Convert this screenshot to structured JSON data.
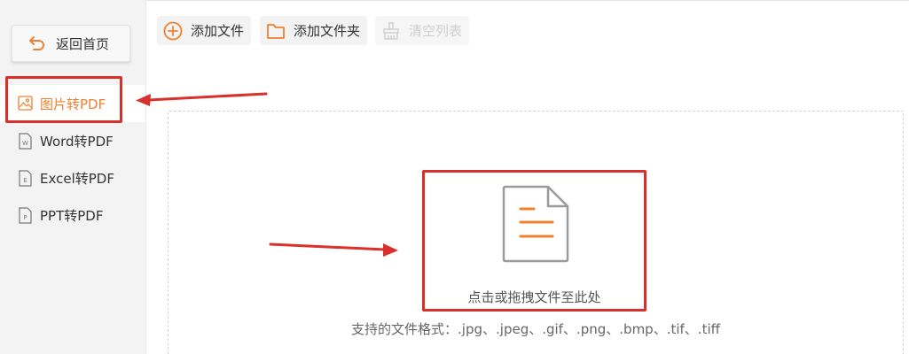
{
  "sidebar": {
    "back_label": "返回首页",
    "items": [
      {
        "label": "图片转PDF",
        "active": true,
        "icon": "image-icon"
      },
      {
        "label": "Word转PDF",
        "active": false,
        "icon": "word-file-icon"
      },
      {
        "label": "Excel转PDF",
        "active": false,
        "icon": "excel-file-icon"
      },
      {
        "label": "PPT转PDF",
        "active": false,
        "icon": "ppt-file-icon"
      }
    ]
  },
  "toolbar": {
    "add_file_label": "添加文件",
    "add_folder_label": "添加文件夹",
    "clear_list_label": "清空列表"
  },
  "dropzone": {
    "prompt": "点击或拖拽文件至此处",
    "supported_formats": "支持的文件格式：.jpg、.jpeg、.gif、.png、.bmp、.tif、.tiff"
  },
  "colors": {
    "accent": "#f0802f",
    "annotation_red": "#d9302c",
    "sidebar_bg": "#f3f3f3"
  }
}
